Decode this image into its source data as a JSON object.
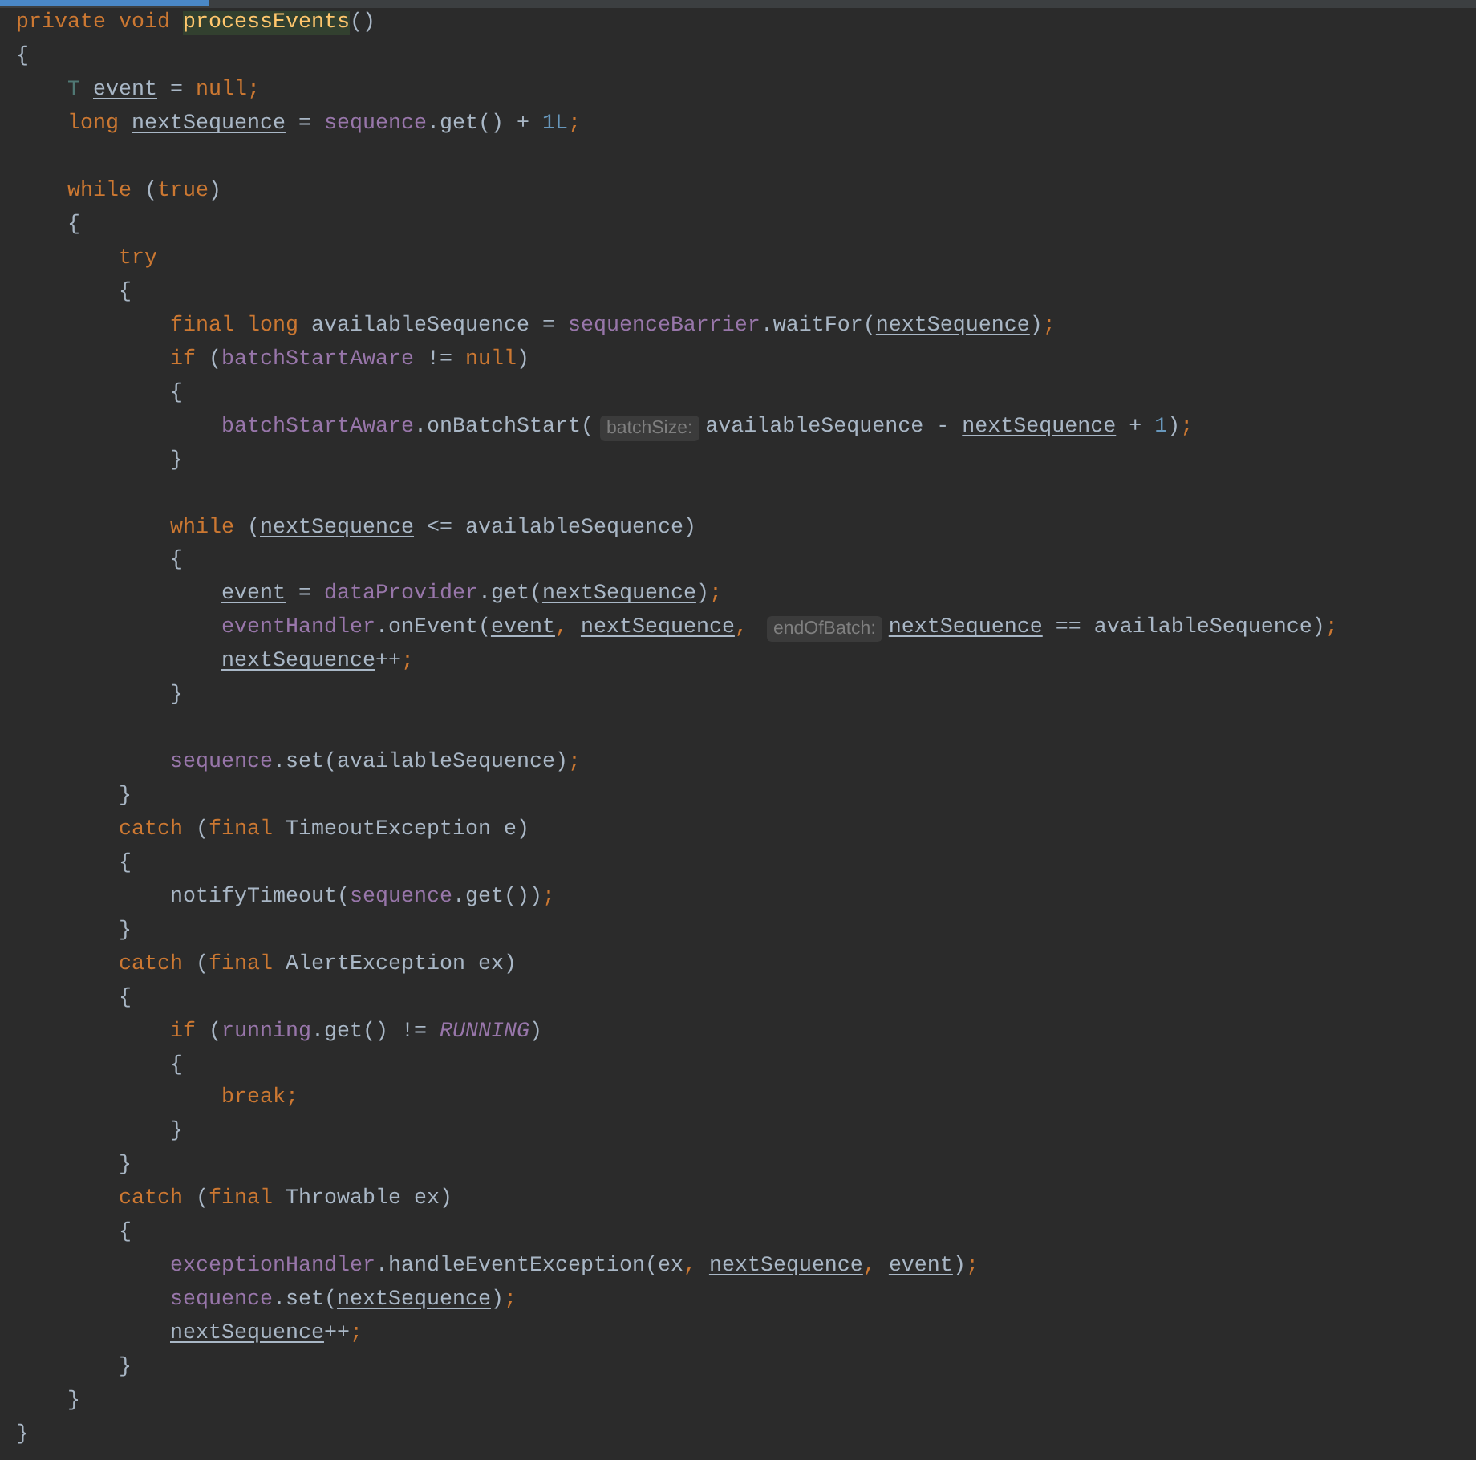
{
  "editor": {
    "tab_indicator": {
      "selected": true
    },
    "lines": [
      {
        "kind": "code",
        "tokens": [
          {
            "kind": "keyword",
            "text": "private void "
          },
          {
            "kind": "method_decl",
            "text": "processEvents"
          },
          {
            "kind": "plain",
            "text": "()"
          }
        ]
      },
      {
        "kind": "code",
        "tokens": [
          {
            "kind": "plain",
            "text": "{"
          }
        ],
        "children": [
          {
            "kind": "code",
            "tokens": [
              {
                "kind": "type",
                "text": "T "
              },
              {
                "kind": "reassigned",
                "text": "event"
              },
              {
                "kind": "plain",
                "text": " = "
              },
              {
                "kind": "keyword",
                "text": "null;"
              }
            ]
          },
          {
            "kind": "code",
            "tokens": [
              {
                "kind": "keyword",
                "text": "long "
              },
              {
                "kind": "reassigned",
                "text": "nextSequence"
              },
              {
                "kind": "plain",
                "text": " = "
              },
              {
                "kind": "field",
                "text": "sequence"
              },
              {
                "kind": "plain",
                "text": ".get() + "
              },
              {
                "kind": "number",
                "text": "1L"
              },
              {
                "kind": "keyword",
                "text": ";"
              }
            ]
          },
          {
            "kind": "blank"
          },
          {
            "kind": "code",
            "tokens": [
              {
                "kind": "keyword",
                "text": "while"
              },
              {
                "kind": "plain",
                "text": " ("
              },
              {
                "kind": "keyword",
                "text": "true"
              },
              {
                "kind": "plain",
                "text": ")"
              }
            ]
          },
          {
            "kind": "code",
            "tokens": [
              {
                "kind": "plain",
                "text": "{"
              }
            ],
            "children": [
              {
                "kind": "code",
                "tokens": [
                  {
                    "kind": "keyword",
                    "text": "try"
                  }
                ]
              },
              {
                "kind": "code",
                "tokens": [
                  {
                    "kind": "plain",
                    "text": "{"
                  }
                ],
                "children": [
                  {
                    "kind": "code",
                    "tokens": [
                      {
                        "kind": "keyword",
                        "text": "final long"
                      },
                      {
                        "kind": "plain",
                        "text": " availableSequence = "
                      },
                      {
                        "kind": "field",
                        "text": "sequenceBarrier"
                      },
                      {
                        "kind": "plain",
                        "text": ".waitFor("
                      },
                      {
                        "kind": "reassigned",
                        "text": "nextSequence"
                      },
                      {
                        "kind": "plain",
                        "text": ")"
                      },
                      {
                        "kind": "keyword",
                        "text": ";"
                      }
                    ]
                  },
                  {
                    "kind": "code",
                    "tokens": [
                      {
                        "kind": "keyword",
                        "text": "if"
                      },
                      {
                        "kind": "plain",
                        "text": " ("
                      },
                      {
                        "kind": "field",
                        "text": "batchStartAware"
                      },
                      {
                        "kind": "plain",
                        "text": " != "
                      },
                      {
                        "kind": "keyword",
                        "text": "null"
                      },
                      {
                        "kind": "plain",
                        "text": ")"
                      }
                    ]
                  },
                  {
                    "kind": "code",
                    "tokens": [
                      {
                        "kind": "plain",
                        "text": "{"
                      }
                    ],
                    "children": [
                      {
                        "kind": "code",
                        "tokens": [
                          {
                            "kind": "field",
                            "text": "batchStartAware"
                          },
                          {
                            "kind": "plain",
                            "text": ".onBatchStart("
                          },
                          {
                            "kind": "hint",
                            "text": "batchSize:"
                          },
                          {
                            "kind": "plain",
                            "text": "availableSequence - "
                          },
                          {
                            "kind": "reassigned",
                            "text": "nextSequence"
                          },
                          {
                            "kind": "plain",
                            "text": " + "
                          },
                          {
                            "kind": "number",
                            "text": "1"
                          },
                          {
                            "kind": "plain",
                            "text": ")"
                          },
                          {
                            "kind": "keyword",
                            "text": ";"
                          }
                        ]
                      }
                    ]
                  },
                  {
                    "kind": "code",
                    "tokens": [
                      {
                        "kind": "plain",
                        "text": "}"
                      }
                    ]
                  },
                  {
                    "kind": "blank"
                  },
                  {
                    "kind": "code",
                    "tokens": [
                      {
                        "kind": "keyword",
                        "text": "while"
                      },
                      {
                        "kind": "plain",
                        "text": " ("
                      },
                      {
                        "kind": "reassigned",
                        "text": "nextSequence"
                      },
                      {
                        "kind": "plain",
                        "text": " <= availableSequence)"
                      }
                    ]
                  },
                  {
                    "kind": "code",
                    "tokens": [
                      {
                        "kind": "plain",
                        "text": "{"
                      }
                    ],
                    "children": [
                      {
                        "kind": "code",
                        "tokens": [
                          {
                            "kind": "reassigned",
                            "text": "event"
                          },
                          {
                            "kind": "plain",
                            "text": " = "
                          },
                          {
                            "kind": "field",
                            "text": "dataProvider"
                          },
                          {
                            "kind": "plain",
                            "text": ".get("
                          },
                          {
                            "kind": "reassigned",
                            "text": "nextSequence"
                          },
                          {
                            "kind": "plain",
                            "text": ")"
                          },
                          {
                            "kind": "keyword",
                            "text": ";"
                          }
                        ]
                      },
                      {
                        "kind": "code",
                        "tokens": [
                          {
                            "kind": "field",
                            "text": "eventHandler"
                          },
                          {
                            "kind": "plain",
                            "text": ".onEvent("
                          },
                          {
                            "kind": "reassigned",
                            "text": "event"
                          },
                          {
                            "kind": "keyword",
                            "text": ", "
                          },
                          {
                            "kind": "reassigned",
                            "text": "nextSequence"
                          },
                          {
                            "kind": "keyword",
                            "text": ", "
                          },
                          {
                            "kind": "hint",
                            "text": "endOfBatch:"
                          },
                          {
                            "kind": "reassigned",
                            "text": "nextSequence"
                          },
                          {
                            "kind": "plain",
                            "text": " == availableSequence)"
                          },
                          {
                            "kind": "keyword",
                            "text": ";"
                          }
                        ]
                      },
                      {
                        "kind": "code",
                        "tokens": [
                          {
                            "kind": "reassigned",
                            "text": "nextSequence"
                          },
                          {
                            "kind": "plain",
                            "text": "++"
                          },
                          {
                            "kind": "keyword",
                            "text": ";"
                          }
                        ]
                      }
                    ]
                  },
                  {
                    "kind": "code",
                    "tokens": [
                      {
                        "kind": "plain",
                        "text": "}"
                      }
                    ]
                  },
                  {
                    "kind": "blank"
                  },
                  {
                    "kind": "code",
                    "tokens": [
                      {
                        "kind": "field",
                        "text": "sequence"
                      },
                      {
                        "kind": "plain",
                        "text": ".set(availableSequence)"
                      },
                      {
                        "kind": "keyword",
                        "text": ";"
                      }
                    ]
                  }
                ]
              },
              {
                "kind": "code",
                "tokens": [
                  {
                    "kind": "plain",
                    "text": "}"
                  }
                ]
              },
              {
                "kind": "code",
                "tokens": [
                  {
                    "kind": "keyword",
                    "text": "catch"
                  },
                  {
                    "kind": "plain",
                    "text": " ("
                  },
                  {
                    "kind": "keyword",
                    "text": "final"
                  },
                  {
                    "kind": "plain",
                    "text": " TimeoutException e)"
                  }
                ]
              },
              {
                "kind": "code",
                "tokens": [
                  {
                    "kind": "plain",
                    "text": "{"
                  }
                ],
                "children": [
                  {
                    "kind": "code",
                    "tokens": [
                      {
                        "kind": "plain",
                        "text": "notifyTimeout("
                      },
                      {
                        "kind": "field",
                        "text": "sequence"
                      },
                      {
                        "kind": "plain",
                        "text": ".get())"
                      },
                      {
                        "kind": "keyword",
                        "text": ";"
                      }
                    ]
                  }
                ]
              },
              {
                "kind": "code",
                "tokens": [
                  {
                    "kind": "plain",
                    "text": "}"
                  }
                ]
              },
              {
                "kind": "code",
                "tokens": [
                  {
                    "kind": "keyword",
                    "text": "catch"
                  },
                  {
                    "kind": "plain",
                    "text": " ("
                  },
                  {
                    "kind": "keyword",
                    "text": "final"
                  },
                  {
                    "kind": "plain",
                    "text": " AlertException ex)"
                  }
                ]
              },
              {
                "kind": "code",
                "tokens": [
                  {
                    "kind": "plain",
                    "text": "{"
                  }
                ],
                "children": [
                  {
                    "kind": "code",
                    "tokens": [
                      {
                        "kind": "keyword",
                        "text": "if"
                      },
                      {
                        "kind": "plain",
                        "text": " ("
                      },
                      {
                        "kind": "field",
                        "text": "running"
                      },
                      {
                        "kind": "plain",
                        "text": ".get() != "
                      },
                      {
                        "kind": "constant",
                        "text": "RUNNING"
                      },
                      {
                        "kind": "plain",
                        "text": ")"
                      }
                    ]
                  },
                  {
                    "kind": "code",
                    "tokens": [
                      {
                        "kind": "plain",
                        "text": "{"
                      }
                    ],
                    "children": [
                      {
                        "kind": "code",
                        "tokens": [
                          {
                            "kind": "keyword",
                            "text": "break;"
                          }
                        ]
                      }
                    ]
                  },
                  {
                    "kind": "code",
                    "tokens": [
                      {
                        "kind": "plain",
                        "text": "}"
                      }
                    ]
                  }
                ]
              },
              {
                "kind": "code",
                "tokens": [
                  {
                    "kind": "plain",
                    "text": "}"
                  }
                ]
              },
              {
                "kind": "code",
                "tokens": [
                  {
                    "kind": "keyword",
                    "text": "catch"
                  },
                  {
                    "kind": "plain",
                    "text": " ("
                  },
                  {
                    "kind": "keyword",
                    "text": "final"
                  },
                  {
                    "kind": "plain",
                    "text": " Throwable ex)"
                  }
                ]
              },
              {
                "kind": "code",
                "tokens": [
                  {
                    "kind": "plain",
                    "text": "{"
                  }
                ],
                "children": [
                  {
                    "kind": "code",
                    "tokens": [
                      {
                        "kind": "field",
                        "text": "exceptionHandler"
                      },
                      {
                        "kind": "plain",
                        "text": ".handleEventException(ex"
                      },
                      {
                        "kind": "keyword",
                        "text": ", "
                      },
                      {
                        "kind": "reassigned",
                        "text": "nextSequence"
                      },
                      {
                        "kind": "keyword",
                        "text": ", "
                      },
                      {
                        "kind": "reassigned",
                        "text": "event"
                      },
                      {
                        "kind": "plain",
                        "text": ")"
                      },
                      {
                        "kind": "keyword",
                        "text": ";"
                      }
                    ]
                  },
                  {
                    "kind": "code",
                    "tokens": [
                      {
                        "kind": "field",
                        "text": "sequence"
                      },
                      {
                        "kind": "plain",
                        "text": ".set("
                      },
                      {
                        "kind": "reassigned",
                        "text": "nextSequence"
                      },
                      {
                        "kind": "plain",
                        "text": ")"
                      },
                      {
                        "kind": "keyword",
                        "text": ";"
                      }
                    ]
                  },
                  {
                    "kind": "code",
                    "tokens": [
                      {
                        "kind": "reassigned",
                        "text": "nextSequence"
                      },
                      {
                        "kind": "plain",
                        "text": "++"
                      },
                      {
                        "kind": "keyword",
                        "text": ";"
                      }
                    ]
                  }
                ]
              },
              {
                "kind": "code",
                "tokens": [
                  {
                    "kind": "plain",
                    "text": "}"
                  }
                ]
              }
            ]
          },
          {
            "kind": "code",
            "tokens": [
              {
                "kind": "plain",
                "text": "}"
              }
            ]
          }
        ]
      },
      {
        "kind": "code",
        "tokens": [
          {
            "kind": "plain",
            "text": "}"
          }
        ]
      }
    ]
  }
}
